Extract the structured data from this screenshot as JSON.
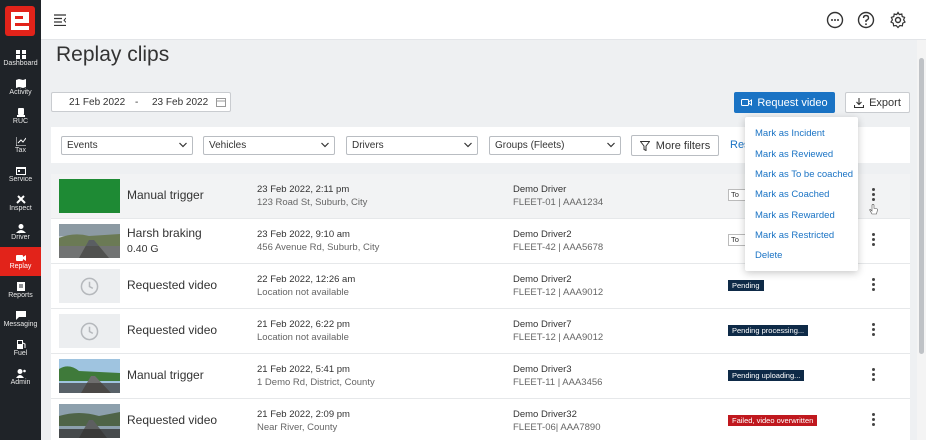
{
  "sidebar": {
    "items": [
      {
        "label": "Dashboard",
        "icon": "dashboard-icon"
      },
      {
        "label": "Activity",
        "icon": "map-icon"
      },
      {
        "label": "RUC",
        "icon": "truck-icon"
      },
      {
        "label": "Tax",
        "icon": "chart-icon"
      },
      {
        "label": "Service",
        "icon": "calendar-icon"
      },
      {
        "label": "Inspect",
        "icon": "tools-icon"
      },
      {
        "label": "Driver",
        "icon": "person-icon"
      },
      {
        "label": "Replay",
        "icon": "camera-icon"
      },
      {
        "label": "Reports",
        "icon": "report-icon"
      },
      {
        "label": "Messaging",
        "icon": "chat-icon"
      },
      {
        "label": "Fuel",
        "icon": "fuel-icon"
      },
      {
        "label": "Admin",
        "icon": "admin-icon"
      }
    ]
  },
  "page": {
    "title": "Replay clips"
  },
  "toolbar": {
    "date_from": "21 Feb 2022",
    "date_sep": "-",
    "date_to": "23 Feb 2022",
    "request_label": "Request video",
    "export_label": "Export"
  },
  "filters": {
    "events": "Events",
    "vehicles": "Vehicles",
    "drivers": "Drivers",
    "groups": "Groups (Fleets)",
    "more": "More filters",
    "reset": "Res"
  },
  "rows": [
    {
      "title": "Manual trigger",
      "sub": "",
      "date": "23 Feb 2022, 2:11 pm",
      "address": "123 Road St, Suburb, City",
      "driver": "Demo Driver",
      "fleet": "FLEET-01 | AAA1234",
      "status": "To"
    },
    {
      "title": "Harsh braking",
      "sub": "0.40 G",
      "date": "23 Feb 2022, 9:10 am",
      "address": "456 Avenue Rd, Suburb, City",
      "driver": "Demo Driver2",
      "fleet": "FLEET-42 | AAA5678",
      "status": "To"
    },
    {
      "title": "Requested video",
      "sub": "",
      "date": "22 Feb 2022, 12:26 am",
      "address": "Location not available",
      "driver": "Demo Driver2",
      "fleet": "FLEET-12 | AAA9012",
      "status": "Pending"
    },
    {
      "title": "Requested video",
      "sub": "",
      "date": "21 Feb 2022, 6:22 pm",
      "address": "Location not available",
      "driver": "Demo Driver7",
      "fleet": "FLEET-12 | AAA9012",
      "status": "Pending processing..."
    },
    {
      "title": "Manual trigger",
      "sub": "",
      "date": "21 Feb 2022, 5:41 pm",
      "address": "1 Demo Rd, District, County",
      "driver": "Demo Driver3",
      "fleet": "FLEET-11 | AAA3456",
      "status": "Pending uploading..."
    },
    {
      "title": "Requested video",
      "sub": "",
      "date": "21 Feb 2022, 2:09 pm",
      "address": "Near River, County",
      "driver": "Demo Driver32",
      "fleet": "FLEET-06| AAA7890",
      "status": "Failed, video overwritten"
    }
  ],
  "menu": {
    "items": [
      "Mark as Incident",
      "Mark as Reviewed",
      "Mark as To be coached",
      "Mark as Coached",
      "Mark as Rewarded",
      "Mark as Restricted",
      "Delete"
    ]
  },
  "colors": {
    "brand_red": "#e2231a",
    "primary_blue": "#1a73c4",
    "badge_navy": "#0e2a47",
    "badge_failed": "#c0181e",
    "sidebar_bg": "#1f2328"
  }
}
